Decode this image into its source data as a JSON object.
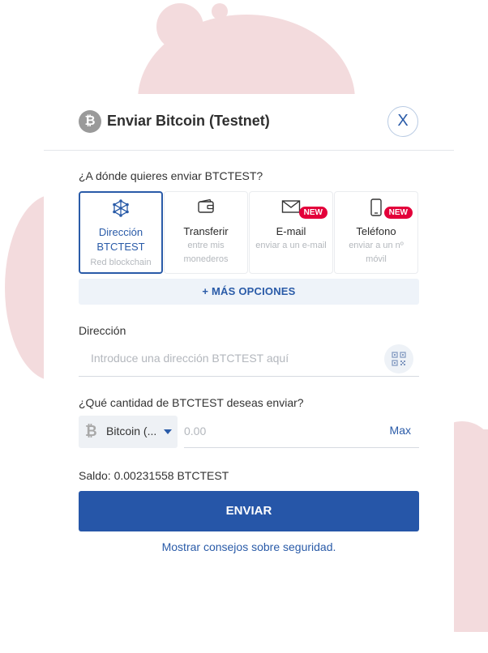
{
  "header": {
    "coin_symbol": "₿",
    "title": "Enviar Bitcoin (Testnet)",
    "close_glyph": "X"
  },
  "destination": {
    "question": "¿A dónde quieres enviar BTCTEST?",
    "options": [
      {
        "label": "Dirección BTCTEST",
        "sub": "Red blockchain",
        "icon": "network-icon",
        "active": true
      },
      {
        "label": "Transferir",
        "sub": "entre mis monederos",
        "icon": "wallet-icon",
        "active": false
      },
      {
        "label": "E-mail",
        "sub": "enviar a un e-mail",
        "icon": "envelope-icon",
        "badge": "NEW",
        "active": false
      },
      {
        "label": "Teléfono",
        "sub": "enviar a un nº móvil",
        "icon": "phone-icon",
        "badge": "NEW",
        "active": false
      }
    ],
    "more_options": "+ MÁS OPCIONES"
  },
  "address": {
    "label": "Dirección",
    "placeholder": "Introduce una dirección BTCTEST aquí",
    "qr_icon": "qr-scan-icon"
  },
  "amount": {
    "question": "¿Qué cantidad de BTCTEST deseas enviar?",
    "currency_icon": "₿",
    "currency_label": "Bitcoin (...",
    "placeholder": "0.00",
    "max_label": "Max"
  },
  "balance_text": "Saldo: 0.00231558 BTCTEST",
  "send_label": "ENVIAR",
  "security_tips": "Mostrar consejos sobre seguridad.",
  "colors": {
    "accent": "#2656a8",
    "new_badge": "#e3003a",
    "blob": "#f3dbdd"
  }
}
